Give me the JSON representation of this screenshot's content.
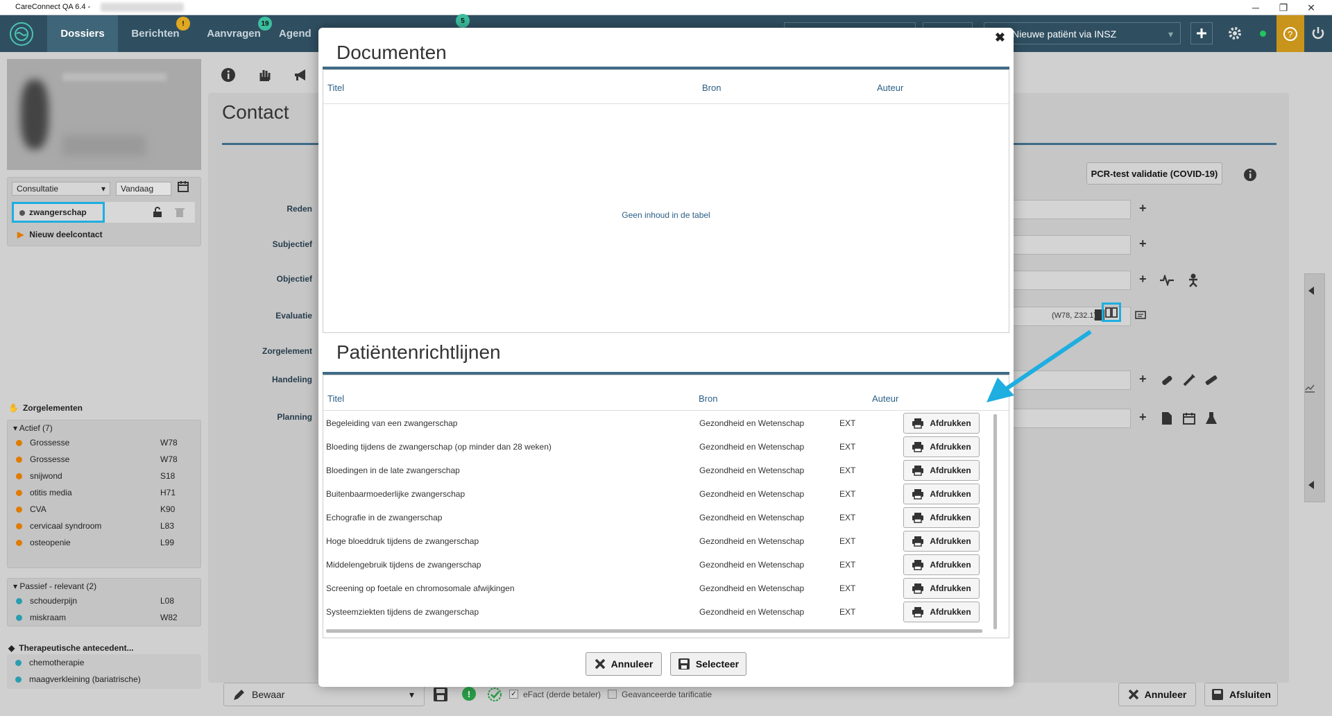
{
  "window": {
    "title": "CareConnect QA 6.4 -"
  },
  "nav": {
    "tabs": [
      {
        "label": "Dossiers"
      },
      {
        "label": "Berichten"
      },
      {
        "label": "Aanvragen"
      },
      {
        "label": "Agend"
      }
    ],
    "badges": {
      "berichten": "!",
      "aanvragen": "19",
      "agenda": "5"
    },
    "new_patient": "Nieuwe patiënt via INSZ"
  },
  "left": {
    "consult_type": "Consultatie",
    "date": "Vandaag",
    "contact_item": "zwangerschap",
    "new_subcontact": "Nieuw deelcontact",
    "zorgelementen_title": "Zorgelementen",
    "actief_header": "Actief (7)",
    "actief": [
      {
        "name": "Grossesse",
        "code": "W78"
      },
      {
        "name": "Grossesse",
        "code": "W78"
      },
      {
        "name": "snijwond",
        "code": "S18"
      },
      {
        "name": "otitis media",
        "code": "H71"
      },
      {
        "name": "CVA",
        "code": "K90"
      },
      {
        "name": "cervicaal syndroom",
        "code": "L83"
      },
      {
        "name": "osteopenie",
        "code": "L99"
      }
    ],
    "passief_header": "Passief - relevant (2)",
    "passief": [
      {
        "name": "schouderpijn",
        "code": "L08"
      },
      {
        "name": "miskraam",
        "code": "W82"
      }
    ],
    "thera_title": "Therapeutische antecedent...",
    "thera": [
      {
        "name": "chemotherapie"
      },
      {
        "name": "maagverkleining (bariatrische)"
      }
    ]
  },
  "contact": {
    "title": "Contact",
    "pcr_button": "PCR-test validatie (COVID-19)",
    "fields": {
      "reden": "Reden",
      "subjectief": "Subjectief",
      "objectief": "Objectief",
      "evaluatie": "Evaluatie",
      "zorgelement": "Zorgelement",
      "handeling": "Handeling",
      "planning": "Planning"
    },
    "evaluatie_codes": "(W78, Z32.1)"
  },
  "bottom": {
    "bewaar": "Bewaar",
    "efact": "eFact (derde betaler)",
    "tarificatie": "Geavanceerde tarificatie",
    "annuleer": "Annuleer",
    "afsluiten": "Afsluiten"
  },
  "modal": {
    "documenten": {
      "title": "Documenten",
      "headers": {
        "titel": "Titel",
        "bron": "Bron",
        "auteur": "Auteur"
      },
      "empty": "Geen inhoud in de tabel"
    },
    "richtlijnen": {
      "title": "Patiëntenrichtlijnen",
      "headers": {
        "titel": "Titel",
        "bron": "Bron",
        "auteur": "Auteur"
      },
      "print_label": "Afdrukken",
      "rows": [
        {
          "titel": "Begeleiding van een zwangerschap",
          "bron": "Gezondheid en Wetenschap",
          "auteur": "EXT"
        },
        {
          "titel": "Bloeding tijdens de zwangerschap (op minder dan 28 weken)",
          "bron": "Gezondheid en Wetenschap",
          "auteur": "EXT"
        },
        {
          "titel": "Bloedingen in de late zwangerschap",
          "bron": "Gezondheid en Wetenschap",
          "auteur": "EXT"
        },
        {
          "titel": "Buitenbaarmoederlijke zwangerschap",
          "bron": "Gezondheid en Wetenschap",
          "auteur": "EXT"
        },
        {
          "titel": "Echografie in de zwangerschap",
          "bron": "Gezondheid en Wetenschap",
          "auteur": "EXT"
        },
        {
          "titel": "Hoge bloeddruk tijdens de zwangerschap",
          "bron": "Gezondheid en Wetenschap",
          "auteur": "EXT"
        },
        {
          "titel": "Middelengebruik tijdens de zwangerschap",
          "bron": "Gezondheid en Wetenschap",
          "auteur": "EXT"
        },
        {
          "titel": "Screening op foetale en chromosomale afwijkingen",
          "bron": "Gezondheid en Wetenschap",
          "auteur": "EXT"
        },
        {
          "titel": "Systeemziekten tijdens de zwangerschap",
          "bron": "Gezondheid en Wetenschap",
          "auteur": "EXT"
        }
      ]
    },
    "annuleer": "Annuleer",
    "selecteer": "Selecteer"
  },
  "colors": {
    "nav": "#2f4f61",
    "accent": "#3f6b87",
    "highlight": "#1eaee0",
    "orange": "#e07b00",
    "teal": "#2a9db0"
  }
}
